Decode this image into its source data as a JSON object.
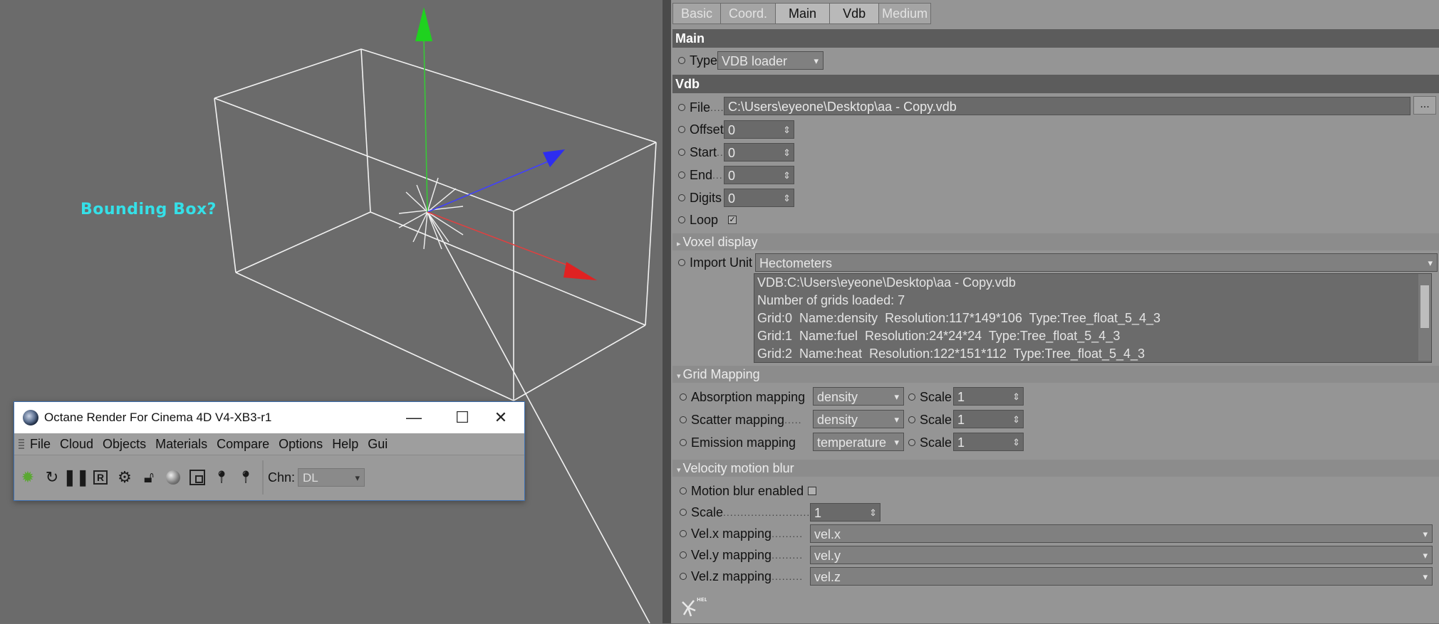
{
  "viewport": {
    "annotation": "Bounding Box?"
  },
  "octane_window": {
    "title": "Octane Render For Cinema 4D V4-XB3-r1",
    "menu": [
      "File",
      "Cloud",
      "Objects",
      "Materials",
      "Compare",
      "Options",
      "Help",
      "Gui"
    ],
    "toolbar_icons": [
      "render-icon",
      "refresh-icon",
      "pause-icon",
      "region-icon",
      "settings-icon",
      "lock-icon",
      "material-ball-icon",
      "resize-icon",
      "pin-f-icon",
      "pin-m-icon"
    ],
    "channel_label": "Chn:",
    "channel_value": "DL"
  },
  "panel": {
    "tabs": [
      "Basic",
      "Coord.",
      "Main",
      "Vdb",
      "Medium"
    ],
    "active_tabs": [
      "Main",
      "Vdb"
    ],
    "sections": {
      "main": "Main",
      "vdb": "Vdb"
    },
    "type": {
      "label": "Type",
      "value": "VDB loader"
    },
    "file": {
      "label": "File",
      "value": "C:\\Users\\eyeone\\Desktop\\aa - Copy.vdb",
      "browse": "..."
    },
    "offset": {
      "label": "Offset",
      "value": "0"
    },
    "start": {
      "label": "Start",
      "value": "0"
    },
    "end": {
      "label": "End",
      "value": "0"
    },
    "digits": {
      "label": "Digits",
      "value": "0"
    },
    "loop": {
      "label": "Loop",
      "checked": true
    },
    "voxel_display": "Voxel display",
    "import_unit": {
      "label": "Import Unit",
      "value": "Hectometers"
    },
    "info_lines": [
      "VDB:C:\\Users\\eyeone\\Desktop\\aa - Copy.vdb",
      "Number of grids loaded: 7",
      "Grid:0  Name:density  Resolution:117*149*106  Type:Tree_float_5_4_3",
      "Grid:1  Name:fuel  Resolution:24*24*24  Type:Tree_float_5_4_3",
      "Grid:2  Name:heat  Resolution:122*151*112  Type:Tree_float_5_4_3"
    ],
    "grid_mapping": {
      "title": "Grid Mapping",
      "rows": [
        {
          "label": "Absorption mapping",
          "value": "density",
          "scale_label": "Scale",
          "scale": "1"
        },
        {
          "label": "Scatter mapping",
          "value": "density",
          "scale_label": "Scale",
          "scale": "1"
        },
        {
          "label": "Emission mapping",
          "value": "temperature",
          "scale_label": "Scale",
          "scale": "1"
        }
      ]
    },
    "velocity": {
      "title": "Velocity motion blur",
      "motion_blur_label": "Motion blur enabled",
      "motion_blur_checked": false,
      "scale_label": "Scale",
      "scale": "1",
      "velx_label": "Vel.x mapping",
      "velx": "vel.x",
      "vely_label": "Vel.y mapping",
      "vely": "vel.y",
      "velz_label": "Vel.z mapping",
      "velz": "vel.z"
    },
    "help_badge": "HELP"
  }
}
